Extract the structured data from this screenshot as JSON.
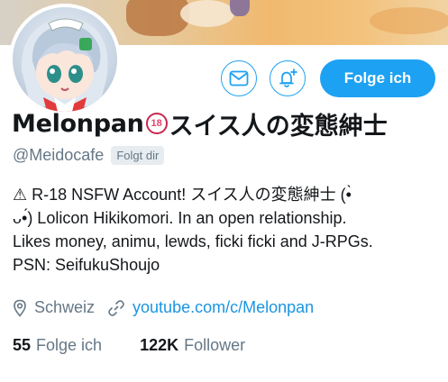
{
  "profile": {
    "name": "Melonpan",
    "badge_text": "18",
    "name_jp": "スイス人の変態紳士",
    "handle": "@Meidocafe",
    "follows_you": "Folgt dir",
    "bio_lines": [
      "⚠ R-18 NSFW Account! スイス人の変態紳士 (•̀",
      "ᴗ•́) Lolicon Hikikomori. In an open relationship.",
      "Likes money, animu, lewds, ficki ficki and J-RPGs.",
      "PSN: SeifukuShoujo"
    ],
    "location": "Schweiz",
    "website": "youtube.com/c/Melonpan"
  },
  "actions": {
    "message_icon": "envelope-icon",
    "notify_icon": "bell-plus-icon",
    "follow_label": "Folge ich"
  },
  "stats": {
    "following_count": "55",
    "following_label": "Folge ich",
    "followers_count": "122K",
    "followers_label": "Follower"
  },
  "colors": {
    "accent": "#1da1f2",
    "secondary_text": "#657786",
    "badge": "#e8426b"
  }
}
